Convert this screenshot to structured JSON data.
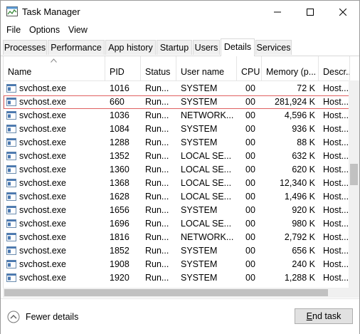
{
  "window": {
    "title": "Task Manager"
  },
  "menu": [
    "File",
    "Options",
    "View"
  ],
  "tabs": [
    {
      "label": "Processes",
      "active": false
    },
    {
      "label": "Performance",
      "active": false
    },
    {
      "label": "App history",
      "active": false
    },
    {
      "label": "Startup",
      "active": false
    },
    {
      "label": "Users",
      "active": false
    },
    {
      "label": "Details",
      "active": true
    },
    {
      "label": "Services",
      "active": false
    }
  ],
  "table": {
    "columns": [
      "Name",
      "PID",
      "Status",
      "User name",
      "CPU",
      "Memory (p...",
      "Descr..."
    ],
    "sorted_column": "Name",
    "rows": [
      {
        "name": "svchost.exe",
        "pid": "1016",
        "status": "Run...",
        "user": "SYSTEM",
        "cpu": "00",
        "memory": "72 K",
        "desc": "Host..."
      },
      {
        "name": "svchost.exe",
        "pid": "660",
        "status": "Run...",
        "user": "SYSTEM",
        "cpu": "00",
        "memory": "281,924 K",
        "desc": "Host...",
        "selected": true
      },
      {
        "name": "svchost.exe",
        "pid": "1036",
        "status": "Run...",
        "user": "NETWORK...",
        "cpu": "00",
        "memory": "4,596 K",
        "desc": "Host..."
      },
      {
        "name": "svchost.exe",
        "pid": "1084",
        "status": "Run...",
        "user": "SYSTEM",
        "cpu": "00",
        "memory": "936 K",
        "desc": "Host..."
      },
      {
        "name": "svchost.exe",
        "pid": "1288",
        "status": "Run...",
        "user": "SYSTEM",
        "cpu": "00",
        "memory": "88 K",
        "desc": "Host..."
      },
      {
        "name": "svchost.exe",
        "pid": "1352",
        "status": "Run...",
        "user": "LOCAL SE...",
        "cpu": "00",
        "memory": "632 K",
        "desc": "Host..."
      },
      {
        "name": "svchost.exe",
        "pid": "1360",
        "status": "Run...",
        "user": "LOCAL SE...",
        "cpu": "00",
        "memory": "620 K",
        "desc": "Host..."
      },
      {
        "name": "svchost.exe",
        "pid": "1368",
        "status": "Run...",
        "user": "LOCAL SE...",
        "cpu": "00",
        "memory": "12,340 K",
        "desc": "Host..."
      },
      {
        "name": "svchost.exe",
        "pid": "1628",
        "status": "Run...",
        "user": "LOCAL SE...",
        "cpu": "00",
        "memory": "1,496 K",
        "desc": "Host..."
      },
      {
        "name": "svchost.exe",
        "pid": "1656",
        "status": "Run...",
        "user": "SYSTEM",
        "cpu": "00",
        "memory": "920 K",
        "desc": "Host..."
      },
      {
        "name": "svchost.exe",
        "pid": "1696",
        "status": "Run...",
        "user": "LOCAL SE...",
        "cpu": "00",
        "memory": "980 K",
        "desc": "Host..."
      },
      {
        "name": "svchost.exe",
        "pid": "1816",
        "status": "Run...",
        "user": "NETWORK...",
        "cpu": "00",
        "memory": "2,792 K",
        "desc": "Host..."
      },
      {
        "name": "svchost.exe",
        "pid": "1852",
        "status": "Run...",
        "user": "SYSTEM",
        "cpu": "00",
        "memory": "656 K",
        "desc": "Host..."
      },
      {
        "name": "svchost.exe",
        "pid": "1908",
        "status": "Run...",
        "user": "SYSTEM",
        "cpu": "00",
        "memory": "240 K",
        "desc": "Host..."
      },
      {
        "name": "svchost.exe",
        "pid": "1920",
        "status": "Run...",
        "user": "SYSTEM",
        "cpu": "00",
        "memory": "1,288 K",
        "desc": "Host..."
      }
    ]
  },
  "footer": {
    "fewer_details": "Fewer details",
    "end_task_prefix": "E",
    "end_task_rest": "nd task"
  },
  "colors": {
    "selection_outline": "#e06060",
    "icon_blue": "#2b6cb0"
  },
  "icons": [
    "task-manager-icon",
    "minimize-icon",
    "maximize-icon",
    "close-icon",
    "sort-up-icon",
    "process-icon",
    "chevron-up-icon"
  ]
}
